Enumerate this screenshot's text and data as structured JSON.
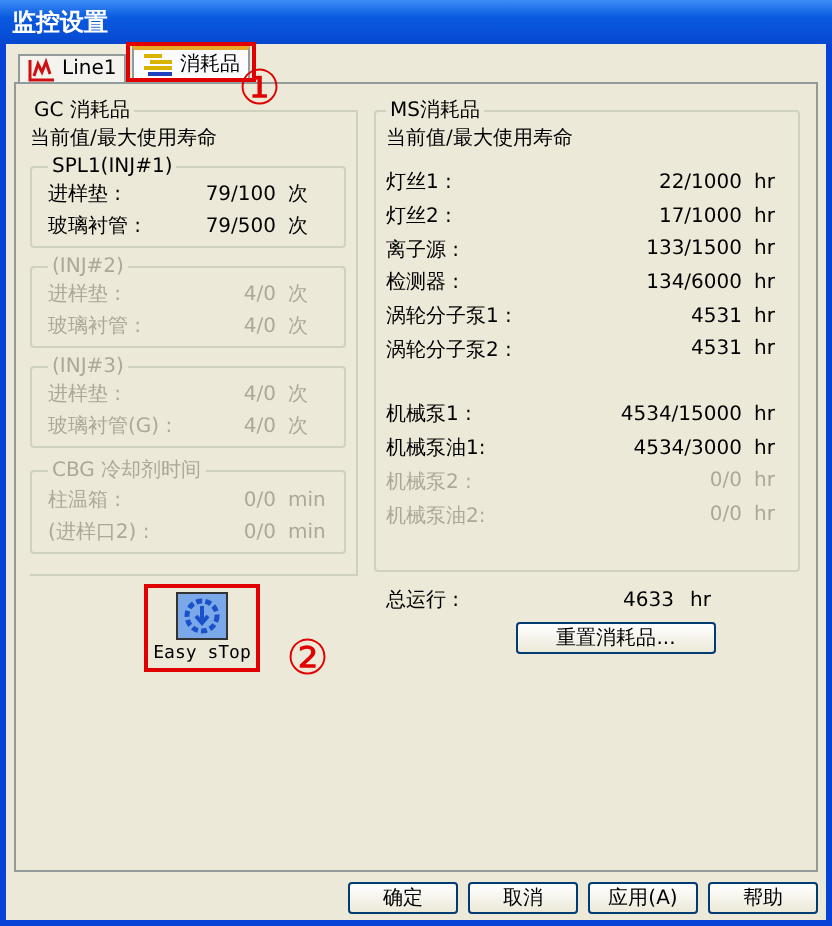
{
  "window": {
    "title": "监控设置"
  },
  "tabs": [
    {
      "label": "Line1",
      "selected": false,
      "highlighted": false
    },
    {
      "label": "消耗品",
      "selected": true,
      "highlighted": true
    }
  ],
  "tabs_callout": "①",
  "gc": {
    "title": "GC 消耗品",
    "subtitle": "当前值/最大使用寿命",
    "groups": [
      {
        "title": "SPL1(INJ#1)",
        "enabled": true,
        "rows": [
          {
            "label": "进样垫 :",
            "value": "79/100",
            "unit": "次"
          },
          {
            "label": "玻璃衬管 :",
            "value": "79/500",
            "unit": "次"
          }
        ]
      },
      {
        "title": "(INJ#2)",
        "enabled": false,
        "rows": [
          {
            "label": "进样垫 :",
            "value": "4/0",
            "unit": "次"
          },
          {
            "label": "玻璃衬管 :",
            "value": "4/0",
            "unit": "次"
          }
        ]
      },
      {
        "title": "(INJ#3)",
        "enabled": false,
        "rows": [
          {
            "label": "进样垫 :",
            "value": "4/0",
            "unit": "次"
          },
          {
            "label": "玻璃衬管(G) :",
            "value": "4/0",
            "unit": "次"
          }
        ]
      },
      {
        "title": "CBG 冷却剂时间",
        "enabled": false,
        "rows": [
          {
            "label": "柱温箱 :",
            "value": "0/0",
            "unit": "min"
          },
          {
            "label": "(进样口2) :",
            "value": "0/0",
            "unit": "min"
          }
        ]
      }
    ]
  },
  "ms": {
    "title": "MS消耗品",
    "subtitle": "当前值/最大使用寿命",
    "sections": [
      [
        {
          "label": "灯丝1 :",
          "value": "22/1000",
          "unit": "hr",
          "enabled": true
        },
        {
          "label": "灯丝2 :",
          "value": "17/1000",
          "unit": "hr",
          "enabled": true
        },
        {
          "label": "离子源 :",
          "value": "133/1500",
          "unit": "hr",
          "enabled": true
        },
        {
          "label": "检测器 :",
          "value": "134/6000",
          "unit": "hr",
          "enabled": true
        },
        {
          "label": "涡轮分子泵1 :",
          "value": "4531",
          "unit": "hr",
          "enabled": true
        },
        {
          "label": "涡轮分子泵2 :",
          "value": "4531",
          "unit": "hr",
          "enabled": true
        }
      ],
      [
        {
          "label": "机械泵1 :",
          "value": "4534/15000",
          "unit": "hr",
          "enabled": true
        },
        {
          "label": "机械泵油1:",
          "value": "4534/3000",
          "unit": "hr",
          "enabled": true
        },
        {
          "label": "机械泵2 :",
          "value": "0/0",
          "unit": "hr",
          "enabled": false
        },
        {
          "label": "机械泵油2:",
          "value": "0/0",
          "unit": "hr",
          "enabled": false
        }
      ]
    ]
  },
  "easy_stop": {
    "label": "Easy sTop",
    "highlighted": true,
    "callout": "②"
  },
  "total": {
    "label": "总运行 :",
    "value": "4633",
    "unit": "hr"
  },
  "reset_button": "重置消耗品...",
  "buttons": [
    "确定",
    "取消",
    "应用(A)",
    "帮助"
  ]
}
